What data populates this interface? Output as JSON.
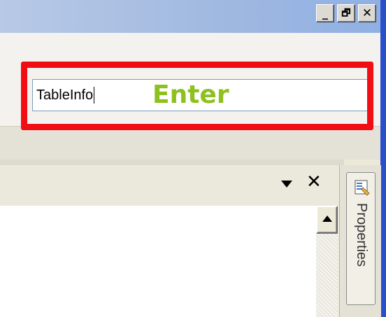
{
  "window": {
    "controls": [
      {
        "name": "minimize",
        "glyph": "_"
      },
      {
        "name": "restore",
        "glyph": "🗗"
      },
      {
        "name": "close",
        "glyph": "✕"
      }
    ]
  },
  "toolbar": {
    "name_input_value": "TableInfo",
    "callout_label": "Enter",
    "highlight_color": "#f00e14",
    "callout_color": "#8dc11f"
  },
  "panel": {
    "dropdown_icon": "chevron-down-icon",
    "close_glyph": "✕"
  },
  "dock": {
    "properties_tab_label": "Properties",
    "properties_icon": "properties-icon"
  }
}
